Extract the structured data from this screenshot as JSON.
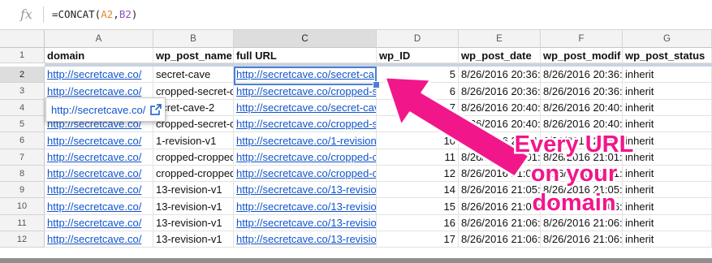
{
  "formula_bar": {
    "icon": "fx-icon",
    "formula_prefix": "=CONCAT(",
    "ref1": "A2",
    "comma": ",",
    "ref2": "B2",
    "formula_suffix": ")"
  },
  "columns": [
    "A",
    "B",
    "C",
    "D",
    "E",
    "F",
    "G"
  ],
  "selected_column": "C",
  "selected_row": "2",
  "header_row": {
    "row_number": "1",
    "cells": [
      "domain",
      "wp_post_name",
      "full URL",
      "wp_ID",
      "wp_post_date",
      "wp_post_modif",
      "wp_post_status"
    ]
  },
  "rows": [
    {
      "n": "2",
      "cells": [
        "http://secretcave.co/",
        "secret-cave",
        "http://secretcave.co/secret-ca",
        "5",
        "8/26/2016 20:36:",
        "8/26/2016 20:36:",
        "inherit"
      ]
    },
    {
      "n": "3",
      "cells": [
        "http://secretcave.co/",
        "cropped-secret-c",
        "http://secretcave.co/cropped-s",
        "6",
        "8/26/2016 20:36:",
        "8/26/2016 20:36:",
        "inherit"
      ]
    },
    {
      "n": "4",
      "cells": [
        "",
        "ecret-cave-2",
        "http://secretcave.co/secret-cav",
        "7",
        "8/26/2016 20:40:",
        "8/26/2016 20:40:",
        "inherit"
      ]
    },
    {
      "n": "5",
      "cells": [
        "http://secretcave.co/",
        "cropped-secret-c",
        "http://secretcave.co/cropped-s",
        "8",
        "8/26/2016 20:40:",
        "8/26/2016 20:40:",
        "inherit"
      ]
    },
    {
      "n": "6",
      "cells": [
        "http://secretcave.co/",
        "1-revision-v1",
        "http://secretcave.co/1-revision",
        "10",
        "8/26/2016 20:54:",
        "8/26/2016 20:54:",
        "inherit"
      ]
    },
    {
      "n": "7",
      "cells": [
        "http://secretcave.co/",
        "cropped-cropped",
        "http://secretcave.co/cropped-c",
        "11",
        "8/26/2016 21:01:",
        "8/26/2016 21:01:",
        "inherit"
      ]
    },
    {
      "n": "8",
      "cells": [
        "http://secretcave.co/",
        "cropped-cropped",
        "http://secretcave.co/cropped-c",
        "12",
        "8/26/2016 21:01:",
        "8/26/2016 21:01:",
        "inherit"
      ]
    },
    {
      "n": "9",
      "cells": [
        "http://secretcave.co/",
        "13-revision-v1",
        "http://secretcave.co/13-revisio",
        "14",
        "8/26/2016 21:05:",
        "8/26/2016 21:05:",
        "inherit"
      ]
    },
    {
      "n": "10",
      "cells": [
        "http://secretcave.co/",
        "13-revision-v1",
        "http://secretcave.co/13-revisio",
        "15",
        "8/26/2016 21:06:",
        "8/26/2016 21:06:",
        "inherit"
      ]
    },
    {
      "n": "11",
      "cells": [
        "http://secretcave.co/",
        "13-revision-v1",
        "http://secretcave.co/13-revisio",
        "16",
        "8/26/2016 21:06:",
        "8/26/2016 21:06:",
        "inherit"
      ]
    },
    {
      "n": "12",
      "cells": [
        "http://secretcave.co/",
        "13-revision-v1",
        "http://secretcave.co/13-revisio",
        "17",
        "8/26/2016 21:06:",
        "8/26/2016 21:06:",
        "inherit"
      ]
    }
  ],
  "link_popup": {
    "url": "http://secretcave.co/",
    "icon": "open-link-icon"
  },
  "callout": {
    "lines": [
      "Every URL",
      "on your",
      "domain"
    ],
    "color": "#f2168b"
  },
  "colors": {
    "link": "#1155cc",
    "selection": "#4a7fd6",
    "header_bg": "#f3f3f3",
    "arrow": "#f2168b"
  }
}
